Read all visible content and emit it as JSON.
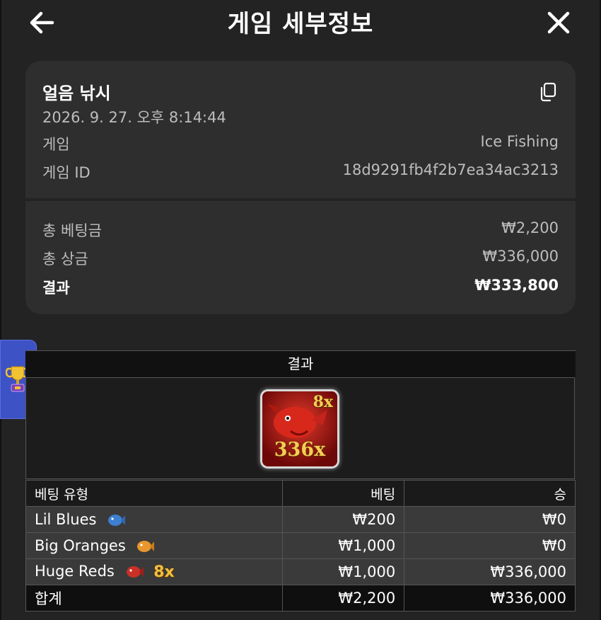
{
  "header": {
    "title": "게임 세부정보",
    "back_icon": "arrow-left-icon",
    "close_icon": "close-icon"
  },
  "game": {
    "name": "얼음 낚시",
    "datetime": "2026. 9. 27. 오후 8:14:44",
    "game_label": "게임",
    "game_value": "Ice Fishing",
    "id_label": "게임 ID",
    "id_value": "18d9291fb4f2b7ea34ac3213",
    "copy_icon": "copy-icon"
  },
  "summary": {
    "total_bet_label": "총 베팅금",
    "total_bet_value": "₩2,200",
    "total_prize_label": "총 상금",
    "total_prize_value": "₩336,000",
    "result_label": "결과",
    "result_value": "₩333,800"
  },
  "side_tab": {
    "icon": "trophy-icon"
  },
  "results": {
    "heading": "결과",
    "card": {
      "multiplier_top": "8x",
      "multiplier_main": "336x"
    },
    "columns": {
      "type": "베팅 유형",
      "bet": "베팅",
      "win": "승"
    },
    "rows": [
      {
        "type": "Lil Blues",
        "icon": "blue-fish-icon",
        "bet": "₩200",
        "win": "₩0"
      },
      {
        "type": "Big Oranges",
        "icon": "orange-fish-icon",
        "bet": "₩1,000",
        "win": "₩0"
      },
      {
        "type": "Huge Reds",
        "icon": "red-fish-icon",
        "multiplier": "8x",
        "bet": "₩1,000",
        "win": "₩336,000"
      }
    ],
    "total": {
      "label": "합계",
      "bet": "₩2,200",
      "win": "₩336,000"
    }
  },
  "colors": {
    "background": "#232323",
    "card": "#2e2e2e",
    "accent_blue": "#3d52c5",
    "multiplier_gold": "#f0c040",
    "red_card": "#8d0f0f"
  }
}
